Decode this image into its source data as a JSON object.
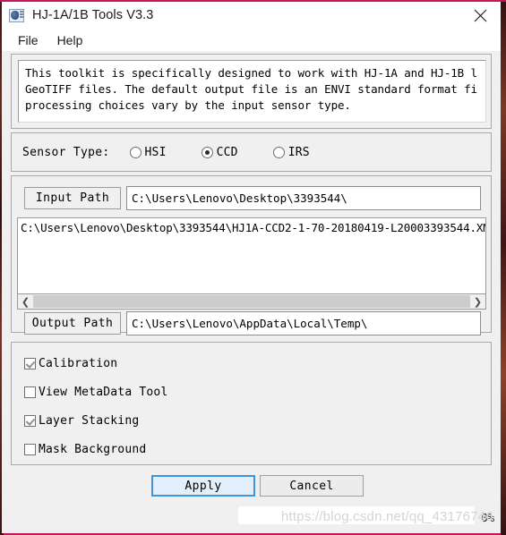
{
  "window": {
    "title": "HJ-1A/1B Tools V3.3",
    "icon": "app-icon",
    "close_icon": "close-icon"
  },
  "menubar": {
    "items": [
      {
        "label": "File"
      },
      {
        "label": "Help"
      }
    ]
  },
  "description": {
    "text": "This toolkit is specifically designed to work with HJ-1A and HJ-1B l\nGeoTIFF files. The default output file is an ENVI standard format fi\nprocessing choices vary by the input sensor type."
  },
  "sensor": {
    "label": "Sensor Type:",
    "options": [
      {
        "label": "HSI",
        "checked": false
      },
      {
        "label": "CCD",
        "checked": true
      },
      {
        "label": "IRS",
        "checked": false
      }
    ],
    "selected": "CCD"
  },
  "paths": {
    "input_button_label": "Input Path",
    "input_value": "C:\\Users\\Lenovo\\Desktop\\3393544\\",
    "output_button_label": "Output Path",
    "output_value": "C:\\Users\\Lenovo\\AppData\\Local\\Temp\\",
    "file_list": [
      "C:\\Users\\Lenovo\\Desktop\\3393544\\HJ1A-CCD2-1-70-20180419-L20003393544.XM"
    ],
    "scroll_left_icon": "chevron-left-icon",
    "scroll_right_icon": "chevron-right-icon"
  },
  "options": [
    {
      "label": "Calibration",
      "checked": true
    },
    {
      "label": "View MetaData Tool",
      "checked": false
    },
    {
      "label": "Layer Stacking",
      "checked": true
    },
    {
      "label": "Mask Background",
      "checked": false
    }
  ],
  "actions": {
    "apply_label": "Apply",
    "cancel_label": "Cancel"
  },
  "status": {
    "progress": "0%"
  },
  "watermark": {
    "text": "https://blog.csdn.net/qq_43176746"
  },
  "colors": {
    "accent": "#3f95dd",
    "apply_fill": "#e3f0fb",
    "window_bg": "#f0f0f0",
    "frame": "#c2185b"
  }
}
